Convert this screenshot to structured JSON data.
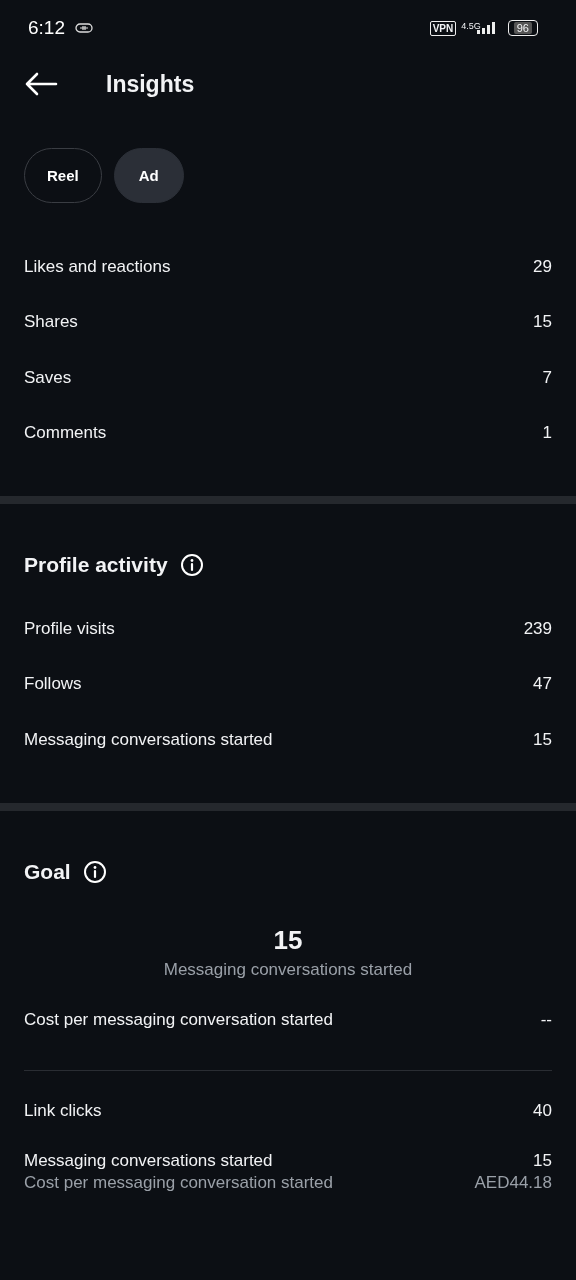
{
  "status_bar": {
    "time": "6:12",
    "vpn": "VPN",
    "network": "4.5G",
    "battery": "96"
  },
  "header": {
    "title": "Insights"
  },
  "tabs": [
    {
      "label": "Reel",
      "selected": false
    },
    {
      "label": "Ad",
      "selected": true
    }
  ],
  "interactions": {
    "rows": [
      {
        "label": "Likes and reactions",
        "value": "29"
      },
      {
        "label": "Shares",
        "value": "15"
      },
      {
        "label": "Saves",
        "value": "7"
      },
      {
        "label": "Comments",
        "value": "1"
      }
    ]
  },
  "profile_activity": {
    "title": "Profile activity",
    "rows": [
      {
        "label": "Profile visits",
        "value": "239"
      },
      {
        "label": "Follows",
        "value": "47"
      },
      {
        "label": "Messaging conversations started",
        "value": "15"
      }
    ]
  },
  "goal": {
    "title": "Goal",
    "headline_value": "15",
    "headline_label": "Messaging conversations started",
    "cost_row": {
      "label": "Cost per messaging conversation started",
      "value": "--"
    },
    "rows": [
      {
        "label": "Link clicks",
        "value": "40"
      },
      {
        "label": "Messaging conversations started",
        "value": "15",
        "sub_label": "Cost per messaging conversation started",
        "sub_value": "AED44.18"
      }
    ]
  }
}
